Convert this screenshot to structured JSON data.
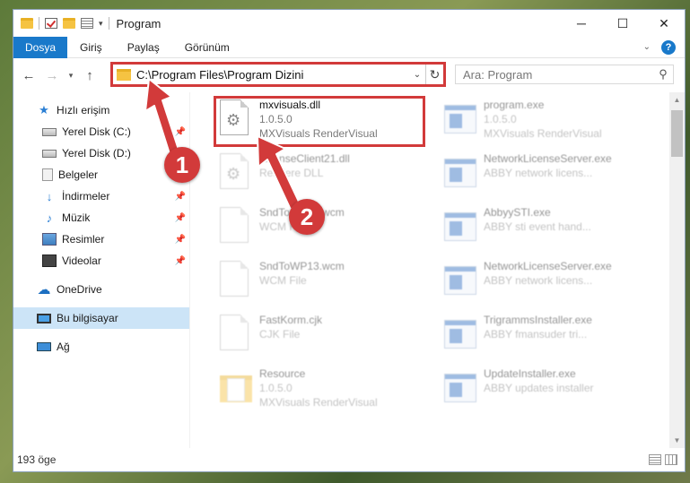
{
  "window": {
    "title": "Program",
    "controls": {
      "minimize": "─",
      "maximize": "☐",
      "close": "✕"
    }
  },
  "ribbon": {
    "tabs": [
      "Dosya",
      "Giriş",
      "Paylaş",
      "Görünüm"
    ],
    "help": "?"
  },
  "nav": {
    "back": "←",
    "forward": "→",
    "dropdown": "▾",
    "up": "↑"
  },
  "address": {
    "path": "C:\\Program Files\\Program Dizini",
    "refresh": "↻",
    "dropdown": "⌄"
  },
  "search": {
    "placeholder": "Ara: Program",
    "icon": "⚲"
  },
  "sidebar": {
    "items": [
      {
        "label": "Hızlı erişim",
        "icon": "star-icon"
      },
      {
        "label": "Yerel Disk (C:)",
        "icon": "drive-icon"
      },
      {
        "label": "Yerel Disk (D:)",
        "icon": "drive-icon"
      },
      {
        "label": "Belgeler",
        "icon": "documents-icon"
      },
      {
        "label": "İndirmeler",
        "icon": "download-icon"
      },
      {
        "label": "Müzik",
        "icon": "music-icon"
      },
      {
        "label": "Resimler",
        "icon": "pictures-icon"
      },
      {
        "label": "Videolar",
        "icon": "videos-icon"
      },
      {
        "label": "OneDrive",
        "icon": "cloud-icon"
      },
      {
        "label": "Bu bilgisayar",
        "icon": "pc-icon"
      },
      {
        "label": "Ağ",
        "icon": "network-icon"
      }
    ]
  },
  "files": [
    {
      "name": "mxvisuals.dll",
      "meta1": "1.0.5.0",
      "meta2": "MXVisuals RenderVisual",
      "type": "dll"
    },
    {
      "name": "LicenseClient21.dll",
      "meta1": "Rendere DLL",
      "meta2": "",
      "type": "dll"
    },
    {
      "name": "SndToWP12.wcm",
      "meta1": "WCM File",
      "meta2": "",
      "type": "doc"
    },
    {
      "name": "SndToWP13.wcm",
      "meta1": "WCM File",
      "meta2": "",
      "type": "doc"
    },
    {
      "name": "FastKorm.cjk",
      "meta1": "CJK File",
      "meta2": "",
      "type": "doc"
    },
    {
      "name": "Resource",
      "meta1": "1.0.5.0",
      "meta2": "MXVisuals RenderVisual",
      "type": "folder"
    },
    {
      "name": "program.exe",
      "meta1": "1.0.5.0",
      "meta2": "MXVisuals RenderVisual",
      "type": "exe"
    },
    {
      "name": "NetworkLicenseServer.exe",
      "meta1": "ABBY network licens...",
      "meta2": "",
      "type": "exe"
    },
    {
      "name": "AbbyySTI.exe",
      "meta1": "ABBY sti event hand...",
      "meta2": "",
      "type": "exe"
    },
    {
      "name": "NetworkLicenseServer.exe",
      "meta1": "ABBY network licens...",
      "meta2": "",
      "type": "exe"
    },
    {
      "name": "TrigrammsInstaller.exe",
      "meta1": "ABBY fmansuder tri...",
      "meta2": "",
      "type": "exe"
    },
    {
      "name": "UpdateInstaller.exe",
      "meta1": "ABBY updates installer",
      "meta2": "",
      "type": "exe"
    }
  ],
  "status": {
    "count": "193 öge"
  },
  "annotations": {
    "step1": "1",
    "step2": "2",
    "color": "#d23a3a"
  }
}
